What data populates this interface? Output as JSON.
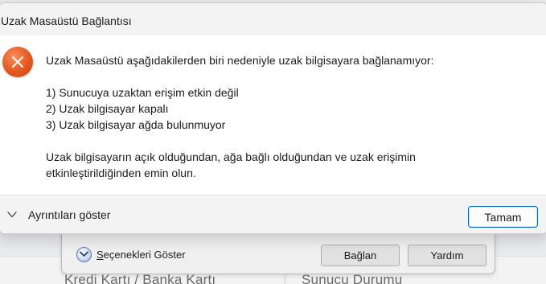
{
  "dialog": {
    "title": "Uzak Masaüstü Bağlantısı",
    "icon": "error-icon",
    "message_intro": "Uzak Masaüstü aşağıdakilerden biri nedeniyle uzak bilgisayara bağlanamıyor:",
    "reasons": [
      "1) Sunucuya uzaktan erişim etkin değil",
      "2) Uzak bilgisayar kapalı",
      "3) Uzak bilgisayar ağda bulunmuyor"
    ],
    "advice_line1": "Uzak bilgisayarın açık olduğundan, ağa bağlı olduğundan ve uzak erişimin",
    "advice_line2": "etkinleştirildiğinden emin olun.",
    "details_label": "Ayrıntıları göster",
    "ok_label": "Tamam"
  },
  "background_dialog": {
    "options_prefix": "S",
    "options_rest": "eçenekleri Göster",
    "connect_label": "Bağlan",
    "help_label": "Yardım"
  },
  "background_page": {
    "section_left": "Kredi Kartı / Banka Kartı",
    "section_right": "Sunucu Durumu"
  },
  "colors": {
    "error_icon": "#e4581f",
    "ok_border": "#0067c0",
    "titlebar": "#f3f3f3"
  }
}
